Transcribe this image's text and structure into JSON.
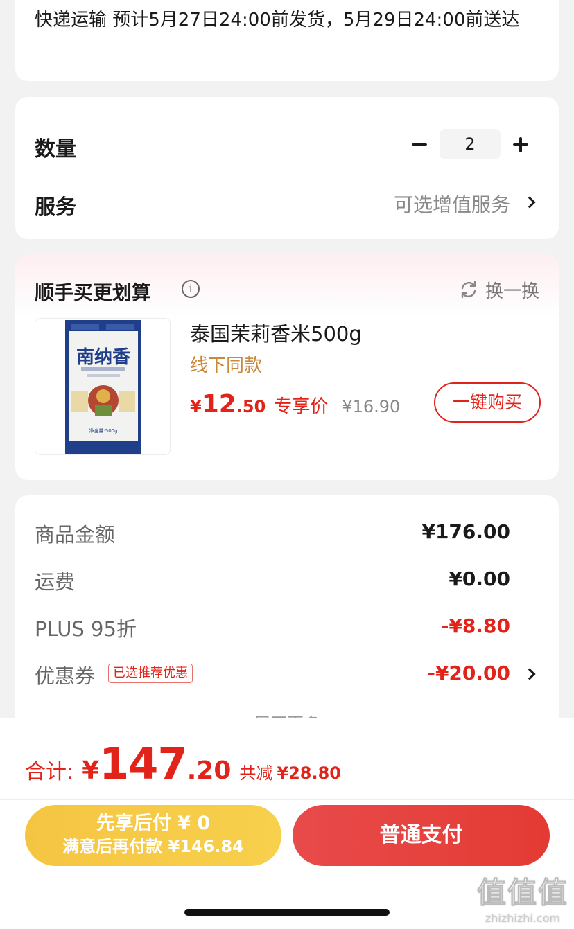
{
  "delivery": {
    "text": "快递运输 预计5月27日24:00前发货，5月29日24:00前送达"
  },
  "quantity": {
    "label": "数量",
    "value": "2"
  },
  "service": {
    "label": "服务",
    "value": "可选增值服务"
  },
  "addon": {
    "title": "顺手买更划算",
    "swap_label": "换一换",
    "product": {
      "image_text": "南纳香",
      "image_weight": "净含量:500g",
      "name": "泰国茉莉香米500g",
      "tag": "线下同款",
      "price_symbol": "¥",
      "price_integer": "12",
      "price_decimal": ".50",
      "price_label": "专享价",
      "original_price": "¥16.90",
      "buy_button": "一键购买"
    }
  },
  "costs": {
    "rows": [
      {
        "label": "商品金额",
        "value": "¥176.00"
      },
      {
        "label": "运费",
        "value": "¥0.00"
      },
      {
        "label": "PLUS 95折",
        "value": "-¥8.80"
      },
      {
        "label": "优惠券",
        "value": "-¥20.00",
        "badge": "已选推荐优惠"
      }
    ],
    "expand_label": "展开更多"
  },
  "checkout": {
    "total_label": "合计:",
    "total_symbol": "¥",
    "total_integer": "147",
    "total_decimal": ".20",
    "saved_label": "共减",
    "saved_value": "¥28.80",
    "pay_later_line1": "先享后付 ¥ 0",
    "pay_later_line2": "满意后再付款 ¥146.84",
    "pay_button": "普通支付"
  },
  "watermark": {
    "logo": "值值值",
    "site": "zhizhizhi.com"
  },
  "colors": {
    "accent_red": "#e2231a",
    "gold": "#c8893a",
    "pay_later_yellow": "#f5c542",
    "background": "#f2f2f2"
  }
}
